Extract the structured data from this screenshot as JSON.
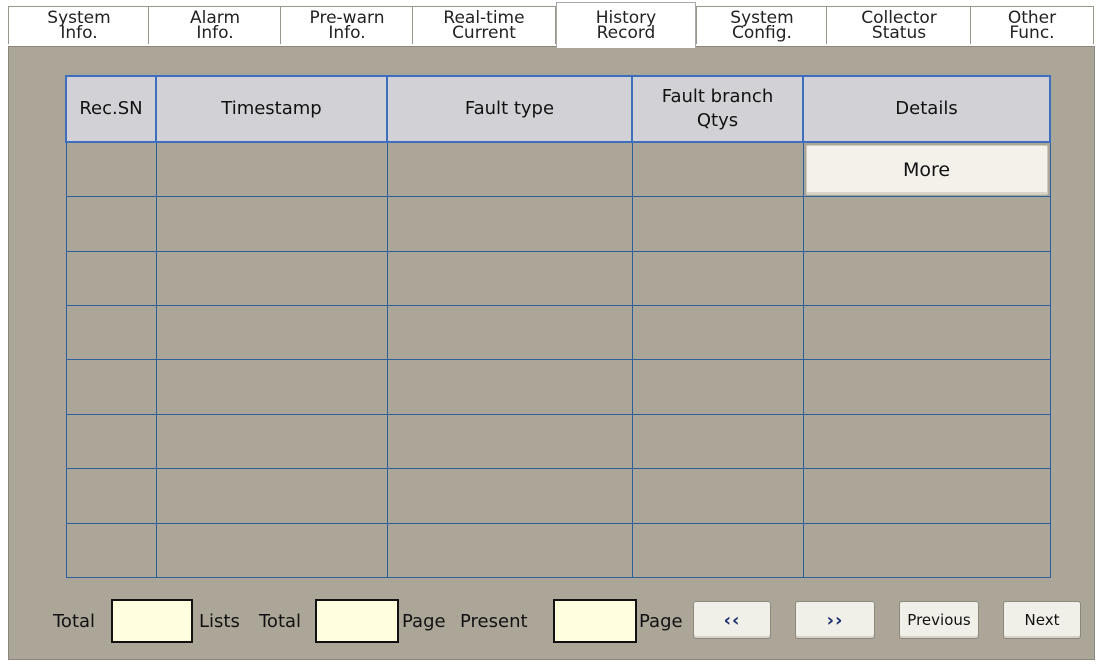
{
  "tabs": [
    {
      "label": "System\nInfo."
    },
    {
      "label": "Alarm\nInfo."
    },
    {
      "label": "Pre-warn\nInfo."
    },
    {
      "label": "Real-time\nCurrent"
    },
    {
      "label": "History\nRecord",
      "active": true
    },
    {
      "label": "System\nConfig."
    },
    {
      "label": "Collector\nStatus"
    },
    {
      "label": "Other\nFunc."
    }
  ],
  "table": {
    "headers": [
      "Rec.SN",
      "Timestamp",
      "Fault type",
      "Fault branch\nQtys",
      "Details"
    ],
    "more_label": "More",
    "row_count": 8
  },
  "footer": {
    "total_label": "Total",
    "lists_label": "Lists",
    "total2_label": "Total",
    "page_label": "Page",
    "present_label": "Present",
    "page2_label": "Page",
    "total_lists_value": "",
    "total_pages_value": "",
    "present_page_value": "",
    "first_label": "‹‹",
    "last_label": "››",
    "previous_label": "Previous",
    "next_label": "Next"
  },
  "colors": {
    "panel_bg": "#aba698",
    "header_bg": "#d2d2d6",
    "grid_line": "#2d5e9e",
    "input_bg": "#ffffe0"
  }
}
